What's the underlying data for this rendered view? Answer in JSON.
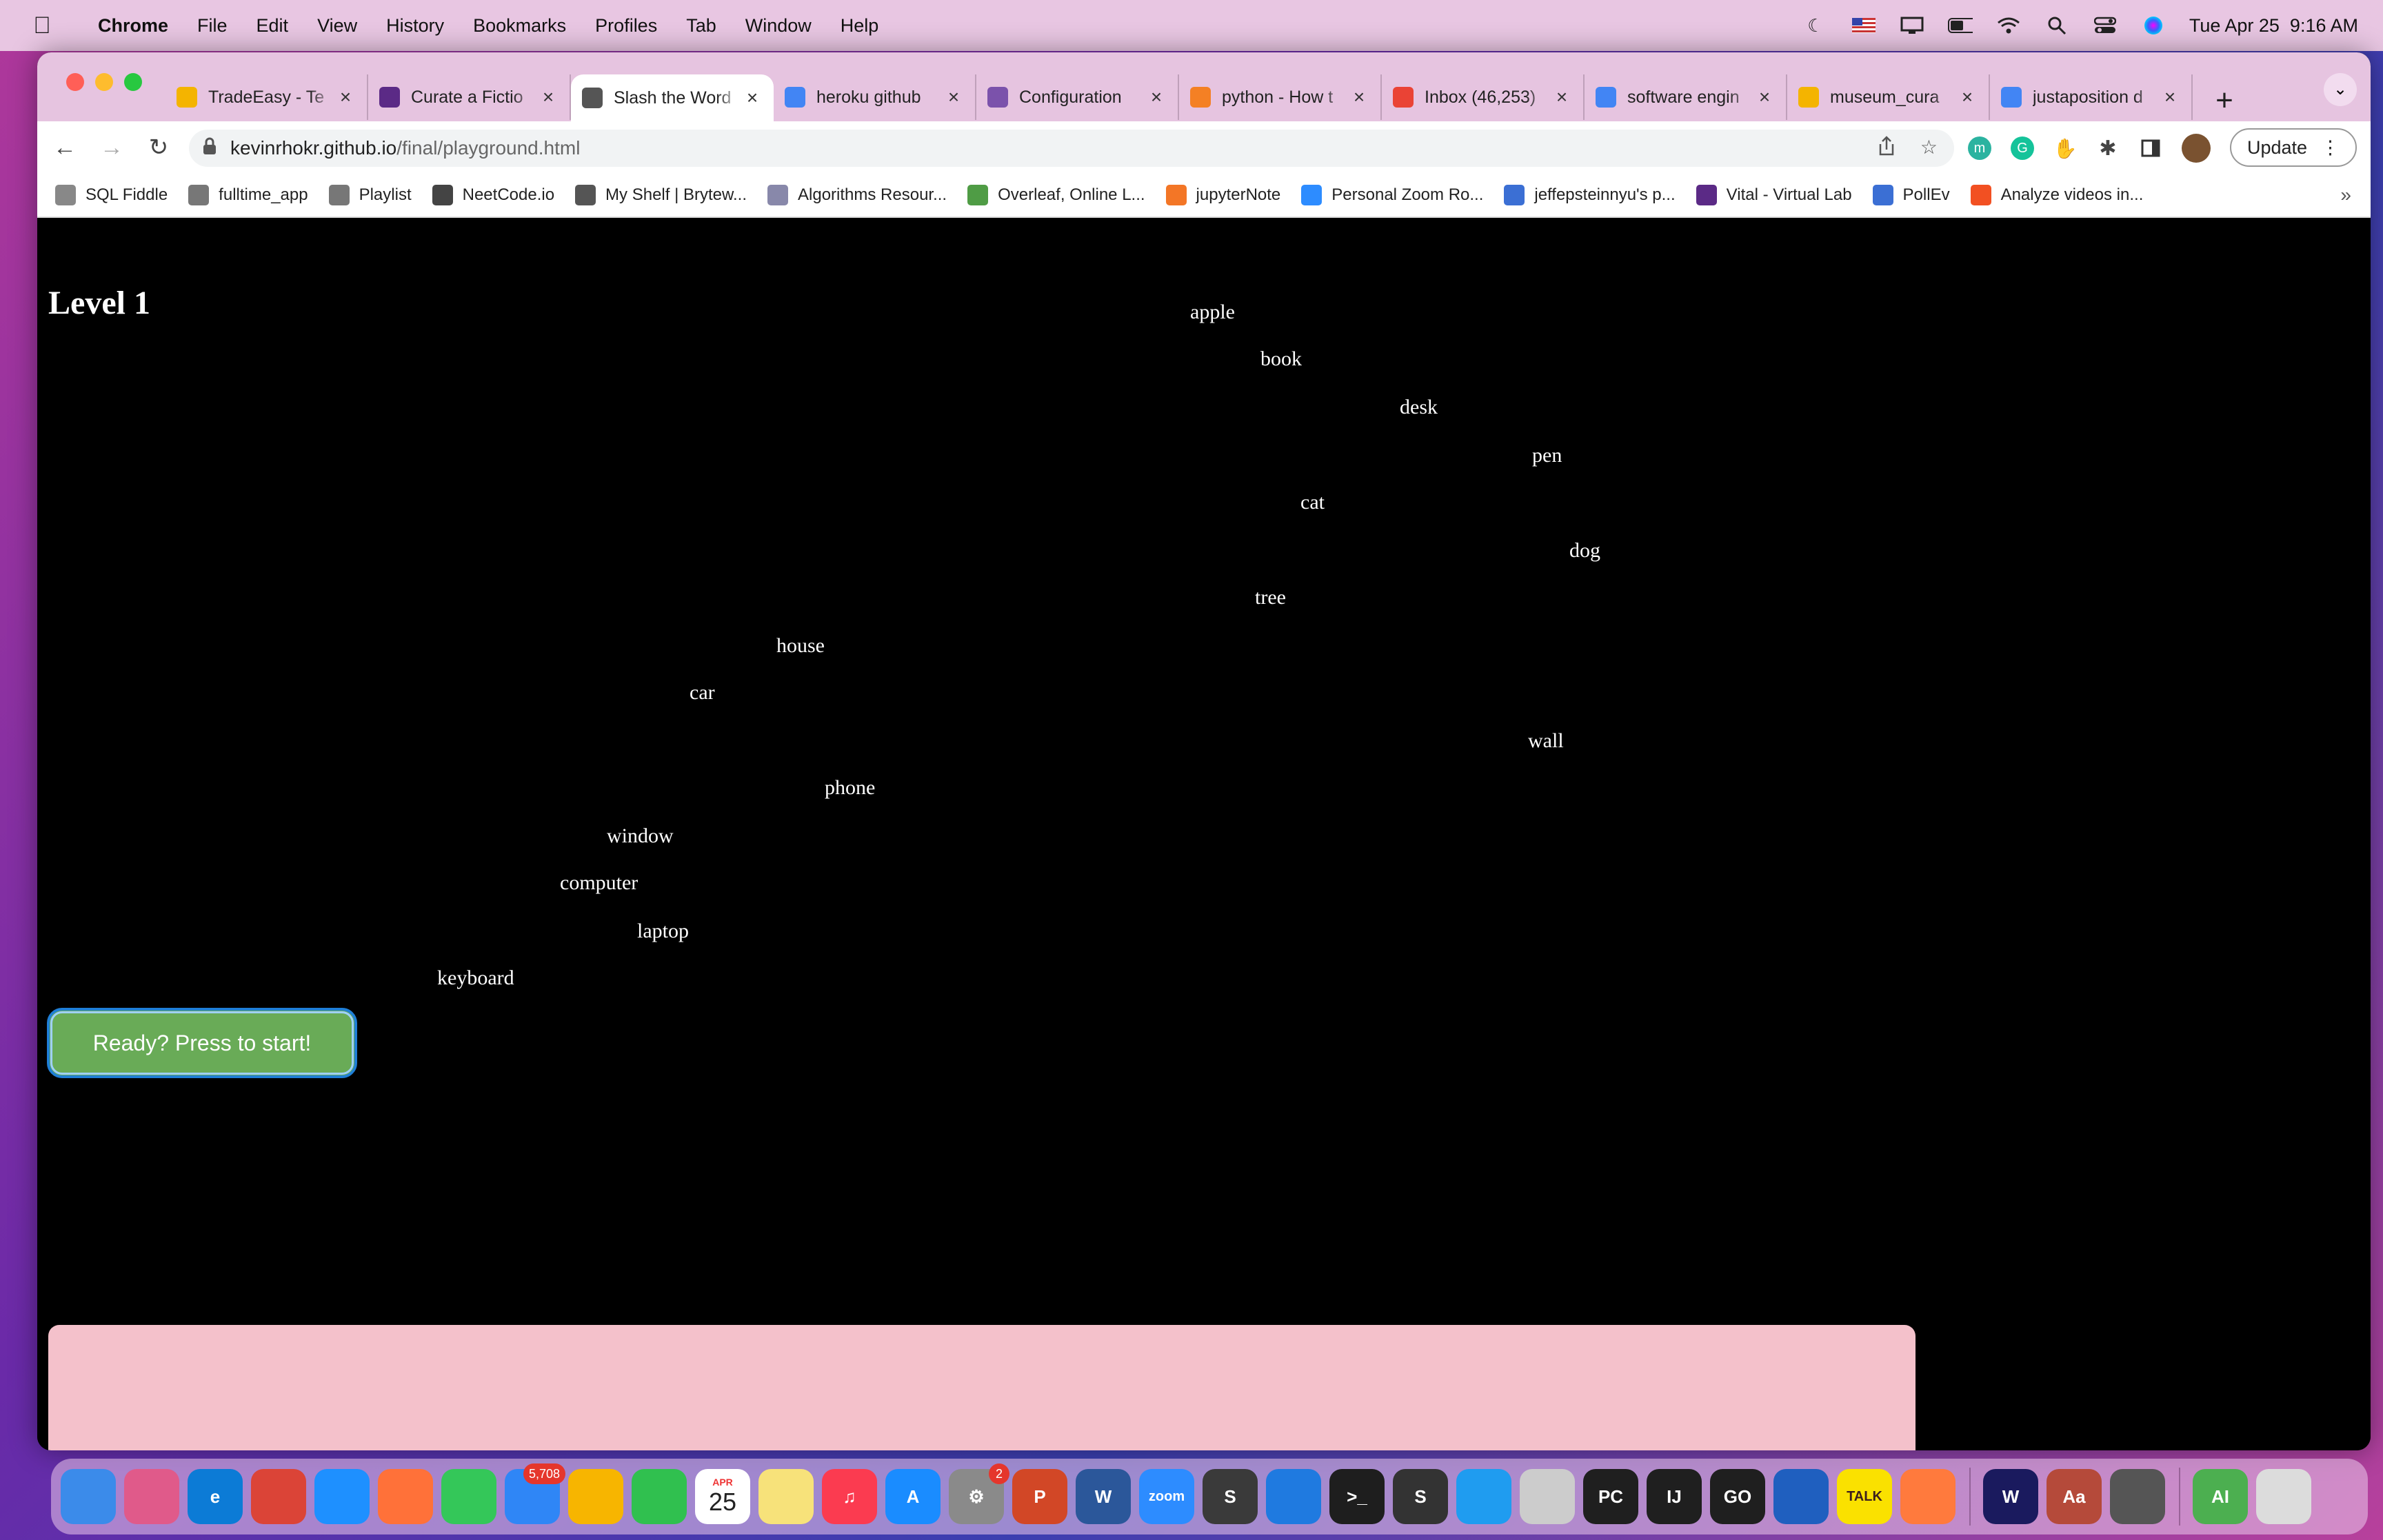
{
  "menubar": {
    "app_name": "Chrome",
    "items": [
      "File",
      "Edit",
      "View",
      "History",
      "Bookmarks",
      "Profiles",
      "Tab",
      "Window",
      "Help"
    ],
    "datetime": "Tue Apr 25  9:16 AM"
  },
  "tabs": [
    {
      "title": "TradeEasy - Te",
      "favicon_color": "#f4b400"
    },
    {
      "title": "Curate a Fictio",
      "favicon_color": "#5b2a86"
    },
    {
      "title": "Slash the Word",
      "favicon_color": "#555555",
      "active": true
    },
    {
      "title": "heroku github",
      "favicon_color": "#4285f4"
    },
    {
      "title": "Configuration",
      "favicon_color": "#7b52ab"
    },
    {
      "title": "python - How t",
      "favicon_color": "#f48024"
    },
    {
      "title": "Inbox (46,253)",
      "favicon_color": "#ea4335"
    },
    {
      "title": "software engin",
      "favicon_color": "#4285f4"
    },
    {
      "title": "museum_cura",
      "favicon_color": "#f4b400"
    },
    {
      "title": "justaposition d",
      "favicon_color": "#4285f4"
    }
  ],
  "address_bar": {
    "host": "kevinrhokr.github.io",
    "path": "/final/playground.html"
  },
  "update_label": "Update",
  "bookmarks": [
    {
      "label": "SQL Fiddle",
      "color": "#888888"
    },
    {
      "label": "fulltime_app",
      "color": "#777777"
    },
    {
      "label": "Playlist",
      "color": "#777777"
    },
    {
      "label": "NeetCode.io",
      "color": "#444444"
    },
    {
      "label": "My Shelf | Brytew...",
      "color": "#555555"
    },
    {
      "label": "Algorithms Resour...",
      "color": "#8888aa"
    },
    {
      "label": "Overleaf, Online L...",
      "color": "#4f9c45"
    },
    {
      "label": "jupyterNote",
      "color": "#f37626"
    },
    {
      "label": "Personal Zoom Ro...",
      "color": "#2d8cff"
    },
    {
      "label": "jeffepsteinnyu's p...",
      "color": "#3b6fd4"
    },
    {
      "label": "Vital - Virtual Lab",
      "color": "#5b2a86"
    },
    {
      "label": "PollEv",
      "color": "#3b6fd4"
    },
    {
      "label": "Analyze videos in...",
      "color": "#f25022"
    }
  ],
  "game": {
    "level_title": "Level 1",
    "words": [
      "apple",
      "book",
      "desk",
      "pen",
      "cat",
      "dog",
      "tree",
      "house",
      "car",
      "wall",
      "phone",
      "window",
      "computer",
      "laptop",
      "keyboard"
    ],
    "start_button": "Ready? Press to start!",
    "input_value": ""
  },
  "dock": {
    "mail_badge": "5,708",
    "settings_badge": "2",
    "calendar_month": "APR",
    "calendar_day": "25"
  }
}
